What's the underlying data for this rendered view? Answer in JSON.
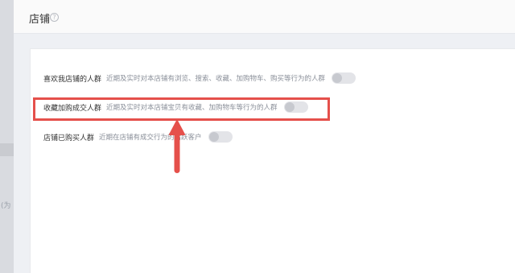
{
  "header": {
    "title": "店铺",
    "help_icon": "?"
  },
  "left_strip": {
    "ghost_text": "(为"
  },
  "rows": [
    {
      "label": "喜欢我店铺的人群",
      "desc": "近期及实时对本店铺有浏览、搜索、收藏、加购物车、购买等行为的人群",
      "toggle": false
    },
    {
      "label": "收藏加购成交人群",
      "desc": "近期及实时对本店铺宝贝有收藏、加购物车等行为的人群",
      "toggle": false
    },
    {
      "label": "店铺已购买人群",
      "desc": "近期在店铺有成交行为的活跃客户",
      "toggle": false
    }
  ],
  "colors": {
    "highlight": "#e5504b",
    "toggle_off": "#e3e4e8"
  }
}
